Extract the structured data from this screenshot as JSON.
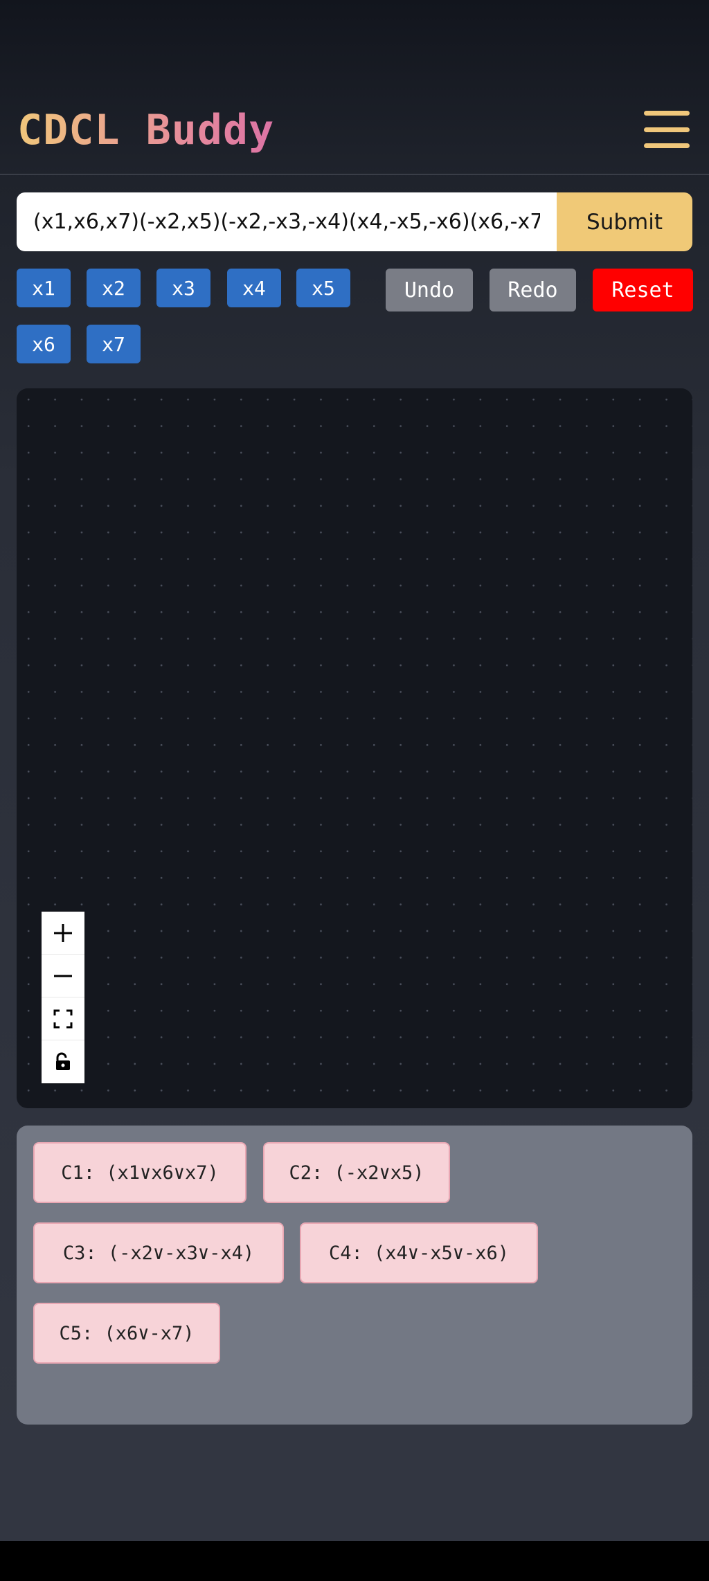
{
  "app": {
    "title": "CDCL Buddy"
  },
  "formula": {
    "value": "(x1,x6,x7)(-x2,x5)(-x2,-x3,-x4)(x4,-x5,-x6)(x6,-x7)",
    "submit_label": "Submit"
  },
  "variables": [
    "x1",
    "x2",
    "x3",
    "x4",
    "x5",
    "x6",
    "x7"
  ],
  "controls": {
    "undo": "Undo",
    "redo": "Redo",
    "reset": "Reset"
  },
  "colors": {
    "variable_button": "#2f6fc4",
    "undo_redo": "#7a7d86",
    "reset": "#ff0000",
    "submit": "#f0c977",
    "clause_bg": "#f7d3d8"
  },
  "clauses": [
    "C1: (x1∨x6∨x7)",
    "C2: (-x2∨x5)",
    "C3: (-x2∨-x3∨-x4)",
    "C4: (x4∨-x5∨-x6)",
    "C5: (x6∨-x7)"
  ],
  "icons": {
    "menu": "hamburger-icon",
    "zoom_in": "plus-icon",
    "zoom_out": "minus-icon",
    "fit": "fit-view-icon",
    "lock": "unlock-icon"
  }
}
